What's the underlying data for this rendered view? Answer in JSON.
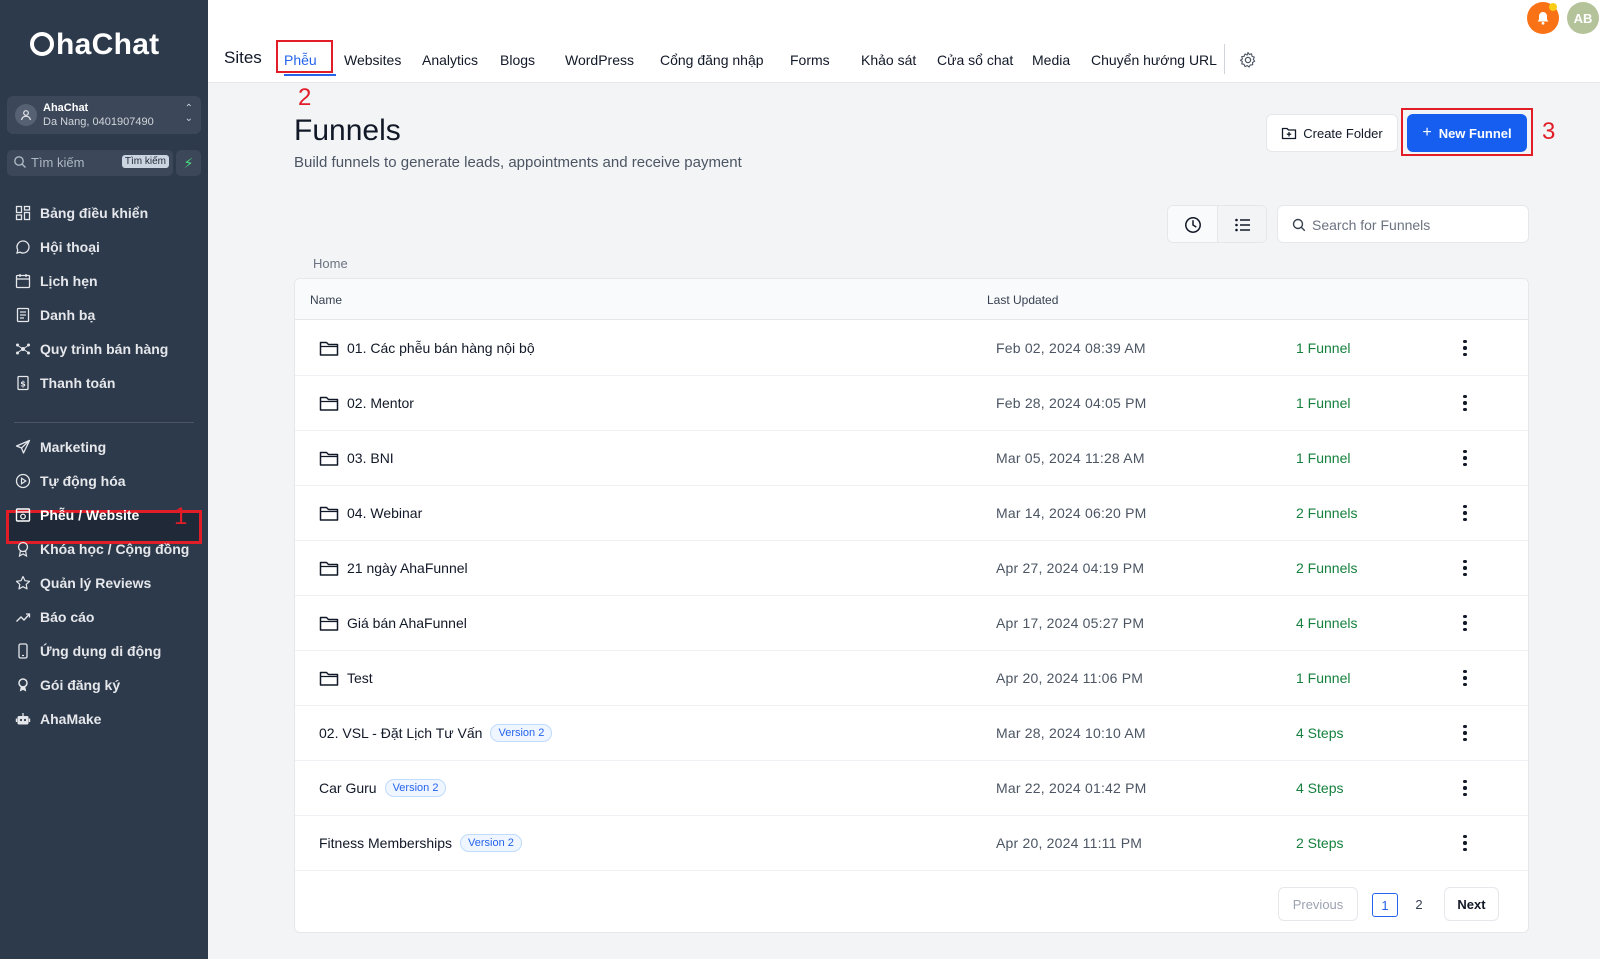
{
  "sidebar": {
    "logo": "haChat",
    "account": {
      "name": "AhaChat",
      "sub": "Da Nang, 0401907490"
    },
    "search_placeholder": "Tìm kiếm",
    "search_shortcut": "Tìm kiếm",
    "items_top": [
      {
        "label": "Bảng điều khiển",
        "icon": "dashboard-icon"
      },
      {
        "label": "Hội thoại",
        "icon": "chat-icon"
      },
      {
        "label": "Lịch hẹn",
        "icon": "calendar-icon"
      },
      {
        "label": "Danh bạ",
        "icon": "contacts-icon"
      },
      {
        "label": "Quy trình bán hàng",
        "icon": "pipeline-icon"
      },
      {
        "label": "Thanh toán",
        "icon": "payment-icon"
      }
    ],
    "items_bottom": [
      {
        "label": "Marketing",
        "icon": "send-icon"
      },
      {
        "label": "Tự động hóa",
        "icon": "automation-icon"
      },
      {
        "label": "Phễu / Website",
        "icon": "website-icon",
        "active": true
      },
      {
        "label": "Khóa học / Cộng đồng",
        "icon": "award-icon"
      },
      {
        "label": "Quản lý Reviews",
        "icon": "star-icon"
      },
      {
        "label": "Báo cáo",
        "icon": "chart-icon"
      },
      {
        "label": "Ứng dụng di động",
        "icon": "mobile-icon"
      },
      {
        "label": "Gói đăng ký",
        "icon": "badge-icon"
      },
      {
        "label": "AhaMake",
        "icon": "robot-icon"
      }
    ]
  },
  "annotations": {
    "one": "1",
    "two": "2",
    "three": "3"
  },
  "topbar": {
    "section": "Sites",
    "tabs": [
      "Phễu",
      "Websites",
      "Analytics",
      "Blogs",
      "WordPress",
      "Cổng đăng nhập",
      "Forms",
      "Khảo sát",
      "Cửa sổ chat",
      "Media",
      "Chuyển hướng URL"
    ],
    "active_tab": "Phễu",
    "avatar_initials": "AB"
  },
  "main": {
    "title": "Funnels",
    "subtitle": "Build funnels to generate leads, appointments and receive payment",
    "create_folder_label": "Create Folder",
    "new_funnel_label": "New Funnel",
    "search_placeholder": "Search for Funnels",
    "breadcrumb": "Home",
    "columns": {
      "name": "Name",
      "updated": "Last Updated"
    },
    "rows": [
      {
        "name": "01. Các phễu bán hàng nội bộ",
        "type": "folder",
        "updated": "Feb 02, 2024 08:39 AM",
        "count": "1 Funnel"
      },
      {
        "name": "02. Mentor",
        "type": "folder",
        "updated": "Feb 28, 2024 04:05 PM",
        "count": "1 Funnel"
      },
      {
        "name": "03. BNI",
        "type": "folder",
        "updated": "Mar 05, 2024 11:28 AM",
        "count": "1 Funnel"
      },
      {
        "name": "04. Webinar",
        "type": "folder",
        "updated": "Mar 14, 2024 06:20 PM",
        "count": "2 Funnels"
      },
      {
        "name": "21 ngày AhaFunnel",
        "type": "folder",
        "updated": "Apr 27, 2024 04:19 PM",
        "count": "2 Funnels"
      },
      {
        "name": "Giá bán AhaFunnel",
        "type": "folder",
        "updated": "Apr 17, 2024 05:27 PM",
        "count": "4 Funnels"
      },
      {
        "name": "Test",
        "type": "folder",
        "updated": "Apr 20, 2024 11:06 PM",
        "count": "1 Funnel"
      },
      {
        "name": "02. VSL - Đặt Lịch Tư Vấn",
        "type": "funnel",
        "badge": "Version 2",
        "updated": "Mar 28, 2024 10:10 AM",
        "count": "4 Steps"
      },
      {
        "name": "Car Guru",
        "type": "funnel",
        "badge": "Version 2",
        "updated": "Mar 22, 2024 01:42 PM",
        "count": "4 Steps"
      },
      {
        "name": "Fitness Memberships",
        "type": "funnel",
        "badge": "Version 2",
        "updated": "Apr 20, 2024 11:11 PM",
        "count": "2 Steps"
      }
    ],
    "pagination": {
      "previous": "Previous",
      "pages": [
        "1",
        "2"
      ],
      "current": "1",
      "next": "Next"
    }
  },
  "colors": {
    "sidebar_bg": "#2d3a4b",
    "primary": "#155eef",
    "annotation_red": "#e11d28",
    "count_green": "#15803d"
  }
}
